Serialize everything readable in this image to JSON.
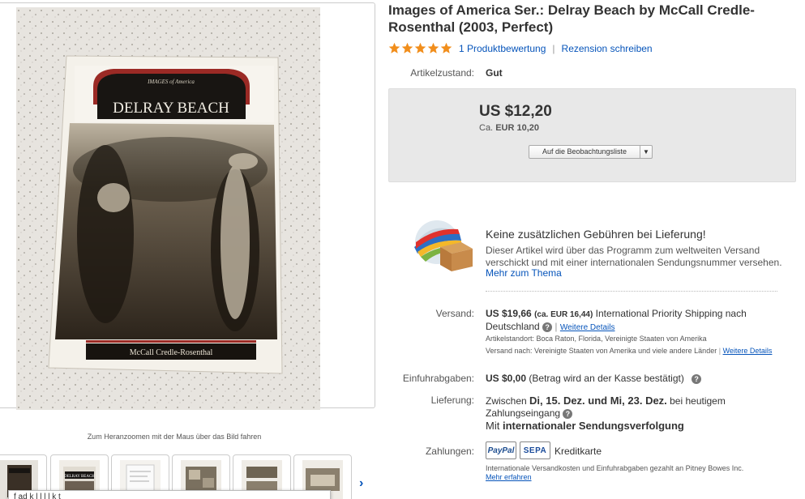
{
  "product": {
    "title": "Images of America Ser.: Delray Beach by McCall Credle-Rosenthal (2003, Perfect)",
    "rating_link": "1 Produktbewertung",
    "review_link": "Rezension schreiben",
    "stars": 5
  },
  "image": {
    "cover_series": "IMAGES of America",
    "cover_title": "DELRAY BEACH",
    "cover_author": "McCall Credle-Rosenthal",
    "zoom_hint": "Zum Heranzoomen mit der Maus über das Bild fahren",
    "thumb_cover_title": "DELRAY BEACH",
    "tooltip_text": "f                 ad              k    l    l   l     l     k      t"
  },
  "condition": {
    "label": "Artikelzustand:",
    "value": "Gut"
  },
  "price": {
    "main": "US $12,20",
    "converted_prefix": "Ca. ",
    "converted_value": "EUR 10,20",
    "watch_button": "Auf die Beobachtungsliste"
  },
  "gsp": {
    "headline": "Keine zusätzlichen Gebühren bei Lieferung!",
    "description": "Dieser Artikel wird über das Programm zum weltweiten Versand verschickt und mit einer internationalen Sendungsnummer versehen.",
    "more_link": "Mehr zum Thema"
  },
  "shipping": {
    "label": "Versand:",
    "cost": "US $19,66",
    "cost_converted": "(ca. EUR 16,44)",
    "service": "International Priority Shipping nach Deutschland",
    "details_link": "Weitere Details",
    "location": "Artikelstandort:  Boca Raton, Florida, Vereinigte Staaten von Amerika",
    "ships_to": "Versand nach:  Vereinigte Staaten von Amerika und viele andere Länder",
    "ships_to_link": "Weitere Details"
  },
  "import": {
    "label": "Einfuhrabgaben:",
    "value": "US $0,00",
    "note": "(Betrag wird an der Kasse bestätigt)"
  },
  "delivery": {
    "label": "Lieferung:",
    "prefix": "Zwischen ",
    "dates": "Di, 15. Dez. und Mi, 23. Dez.",
    "suffix": " bei heutigem Zahlungseingang",
    "tracking_prefix": "Mit ",
    "tracking": "internationaler Sendungsverfolgung"
  },
  "payments": {
    "label": "Zahlungen:",
    "paypal": "PayPal",
    "sepa": "SEPA",
    "card": "Kreditkarte",
    "note": "Internationale Versandkosten und Einfuhrabgaben gezahlt an Pitney Bowes Inc.",
    "more_link": "Mehr erfahren"
  },
  "colors": {
    "link": "#0654ba",
    "star": "#f18e1c",
    "price_box": "#e8e8e8"
  }
}
